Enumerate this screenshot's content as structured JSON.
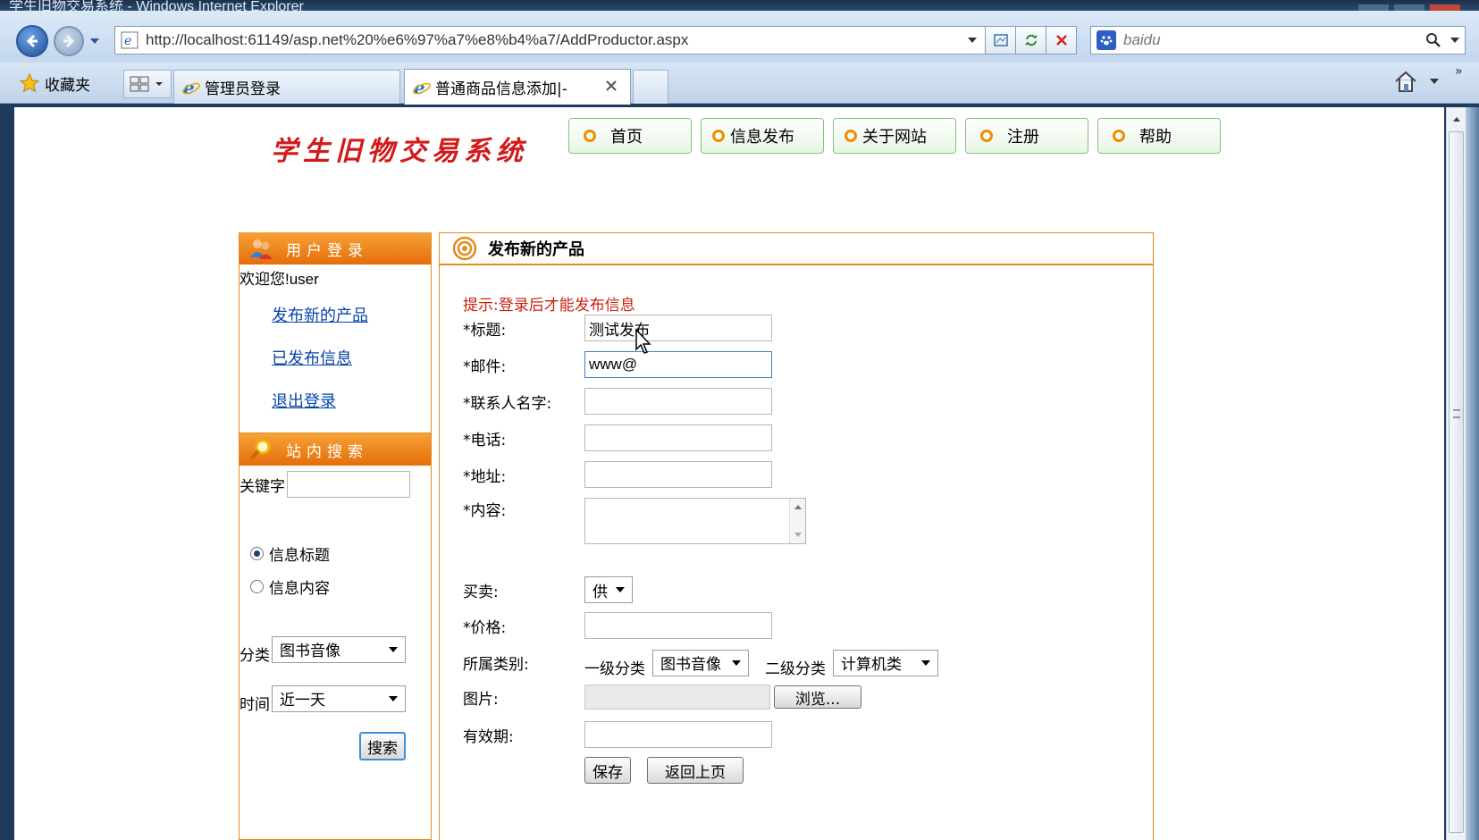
{
  "window": {
    "title": "学生旧物交易系统 - Windows Internet Explorer"
  },
  "browser": {
    "url": "http://localhost:61149/asp.net%20%e6%97%a7%e8%b4%a7/AddProductor.aspx",
    "search_placeholder": "baidu",
    "favorites_label": "收藏夹",
    "tabs": [
      {
        "label": "管理员登录"
      },
      {
        "label": "普通商品信息添加|-"
      }
    ]
  },
  "site": {
    "title": "学生旧物交易系统",
    "nav": [
      "首页",
      "信息发布",
      "关于网站",
      "注册",
      "帮助"
    ]
  },
  "sidebar": {
    "login_header": "用户登录",
    "welcome": "欢迎您!user",
    "links": [
      "发布新的产品",
      "已发布信息",
      "退出登录"
    ],
    "search_header": "站内搜索",
    "keyword_label": "关键字",
    "radios": [
      {
        "label": "信息标题",
        "checked": true
      },
      {
        "label": "信息内容",
        "checked": false
      }
    ],
    "category_label": "分类",
    "category_value": "图书音像",
    "time_label": "时间",
    "time_value": "近一天",
    "search_button": "搜索"
  },
  "form": {
    "header": "发布新的产品",
    "hint": "提示:登录后才能发布信息",
    "title_label": "*标题:",
    "title_value": "测试发布",
    "email_label": "*邮件:",
    "email_value": "www@",
    "contact_label": "*联系人名字:",
    "phone_label": "*电话:",
    "address_label": "*地址:",
    "content_label": "*内容:",
    "trade_label": "买卖:",
    "trade_value": "供",
    "price_label": "*价格:",
    "category_label": "所属类别:",
    "level1_label": "一级分类",
    "level1_value": "图书音像",
    "level2_label": "二级分类",
    "level2_value": "计算机类",
    "image_label": "图片:",
    "browse_button": "浏览...",
    "expiry_label": "有效期:",
    "save_button": "保存",
    "back_button": "返回上页"
  },
  "colors": {
    "accent_orange": "#e58a1e",
    "hint_red": "#c8230f",
    "title_red": "#d21a1a",
    "nav_green": "#7fc67a"
  }
}
